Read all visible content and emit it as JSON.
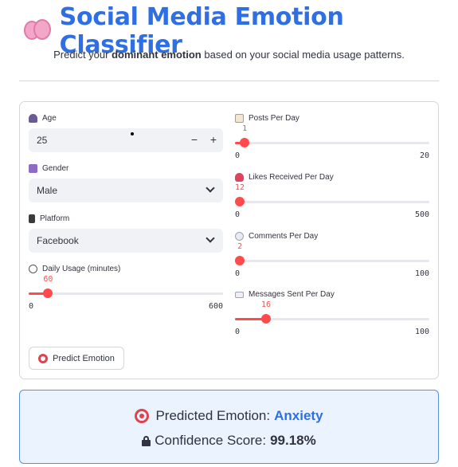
{
  "header": {
    "title": "Social Media Emotion Classifier",
    "subtitle_prefix": "Predict your ",
    "subtitle_bold": "dominant emotion",
    "subtitle_suffix": " based on your social media usage patterns."
  },
  "form": {
    "age": {
      "label": "Age",
      "value": "25",
      "minus": "−",
      "plus": "+"
    },
    "gender": {
      "label": "Gender",
      "selected": "Male"
    },
    "platform": {
      "label": "Platform",
      "selected": "Facebook"
    },
    "daily_usage": {
      "label": "Daily Usage (minutes)",
      "value": 60,
      "min": 0,
      "max": 600
    },
    "posts_per_day": {
      "label": "Posts Per Day",
      "value": 1,
      "min": 0,
      "max": 20
    },
    "likes_received": {
      "label": "Likes Received Per Day",
      "value": 12,
      "min": 0,
      "max": 500
    },
    "comments_per_day": {
      "label": "Comments Per Day",
      "value": 2,
      "min": 0,
      "max": 100
    },
    "messages_sent": {
      "label": "Messages Sent Per Day",
      "value": 16,
      "min": 0,
      "max": 100
    },
    "predict_button": "Predict Emotion"
  },
  "result": {
    "predicted_label": "Predicted Emotion:",
    "predicted_value": "Anxiety",
    "confidence_label": "Confidence Score:",
    "confidence_value": "99.18%"
  },
  "colors": {
    "accent": "#2f6fe4",
    "slider": "#ff4b4b",
    "result_bg": "#eaf3fe"
  }
}
